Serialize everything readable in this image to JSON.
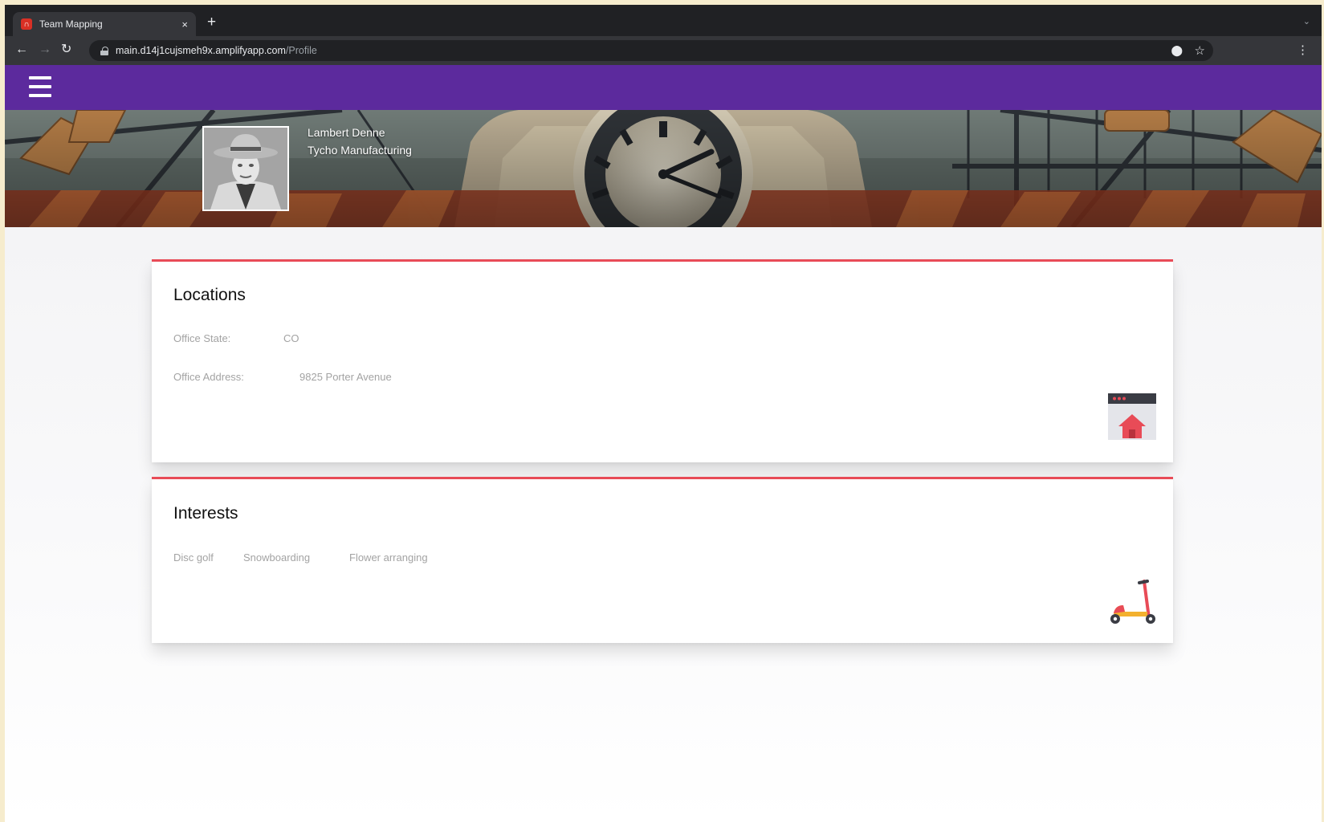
{
  "browser": {
    "tab_title": "Team Mapping",
    "tab_close": "×",
    "new_tab": "+",
    "url_host": "main.d14j1cujsmeh9x.amplifyapp.com",
    "url_path": "/Profile",
    "back_icon": "arrow-left-icon",
    "forward_icon": "arrow-right-icon",
    "reload_icon": "reload-icon"
  },
  "profile": {
    "name": "Lambert Denne",
    "company": "Tycho Manufacturing"
  },
  "locations": {
    "heading": "Locations",
    "office_state_label": "Office State:",
    "office_state_value": "CO",
    "office_address_label": "Office Address:",
    "office_address_value": "9825 Porter Avenue"
  },
  "interests": {
    "heading": "Interests",
    "items": [
      "Disc golf",
      "Snowboarding",
      "Flower arranging"
    ]
  },
  "colors": {
    "app_bar": "#5c2a9d",
    "card_accent": "#e84b57"
  }
}
